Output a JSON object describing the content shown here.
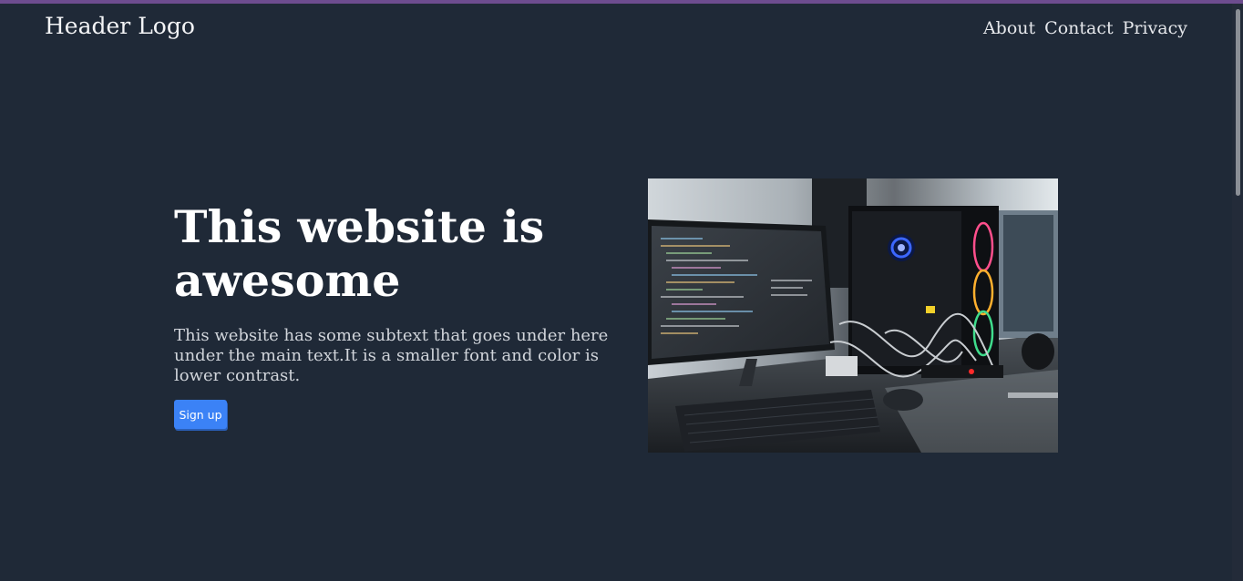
{
  "header": {
    "logo": "Header Logo",
    "nav": [
      "About",
      "Contact",
      "Privacy"
    ]
  },
  "hero": {
    "title": "This website is awesome",
    "subtitle": "This website has some subtext that goes under here under the main text.It is a smaller font and color is lower contrast.",
    "button_label": "Sign up"
  },
  "colors": {
    "background": "#1f2937",
    "accent_bar": "#6d4c8f",
    "button": "#3b82f6"
  }
}
